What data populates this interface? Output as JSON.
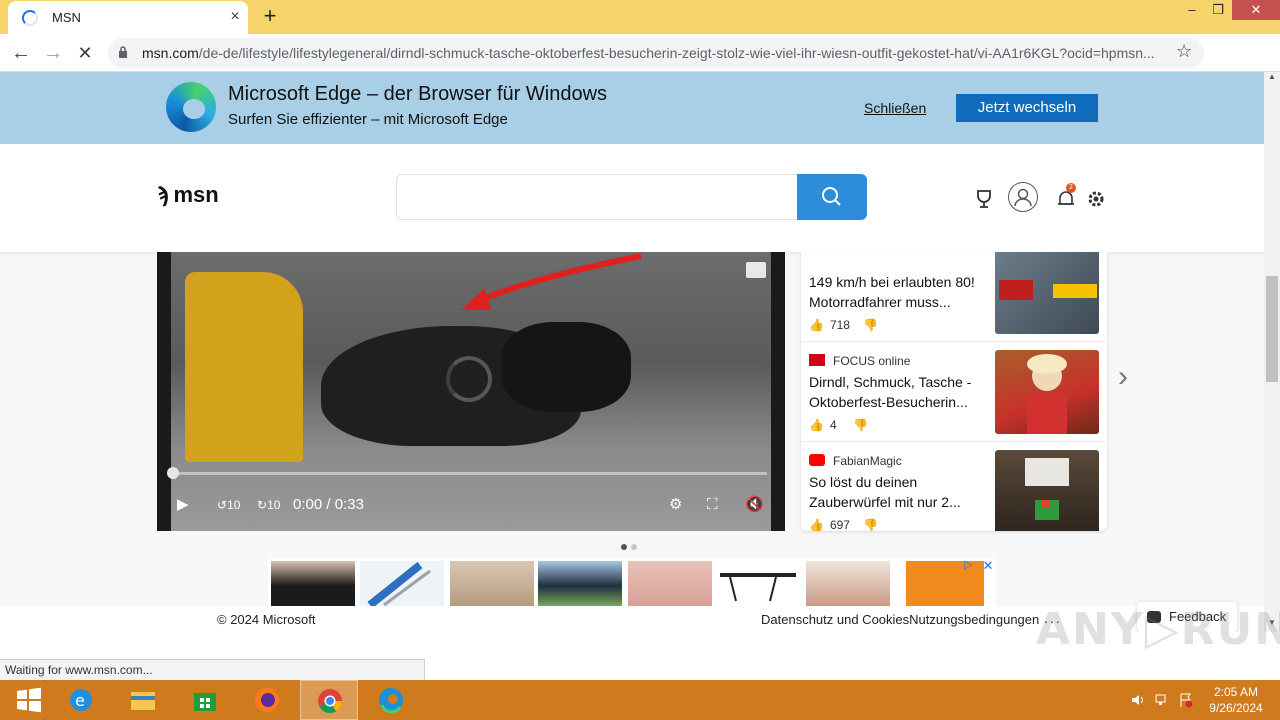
{
  "browser": {
    "tab_title": "MSN",
    "tab_close": "×",
    "new_tab": "+",
    "url_host": "msn.com",
    "url_path": "/de-de/lifestyle/lifestylegeneral/dirndl-schmuck-tasche-oktoberfest-besucherin-zeigt-stolz-wie-viel-ihr-wiesn-outfit-gekostet-hat/vi-AA1r6KGL?ocid=hpmsn...",
    "status_text": "Waiting for www.msn.com..."
  },
  "edge_banner": {
    "title": "Microsoft Edge – der Browser für Windows",
    "subtitle": "Surfen Sie effizienter – mit Microsoft Edge",
    "close_label": "Schließen",
    "switch_label": "Jetzt wechseln"
  },
  "msn": {
    "logo_text": "msn",
    "search_placeholder": "",
    "notification_count": "2"
  },
  "video": {
    "time_current": "0:00",
    "time_separator": "/",
    "time_total": "0:33",
    "progress": 0,
    "rewind_label": "10",
    "forward_label": "10"
  },
  "news": [
    {
      "source": "",
      "headline": "149 km/h bei erlaubten 80! Motorradfahrer muss...",
      "likes": "718",
      "source_color": "#333333"
    },
    {
      "source": "FOCUS online",
      "headline": "Dirndl, Schmuck, Tasche - Oktoberfest-Besucherin...",
      "likes": "4",
      "source_color": "#d0021b"
    },
    {
      "source": "FabianMagic",
      "headline": "So löst du deinen Zauberwürfel mit nur 2...",
      "likes": "697",
      "source_color": "#ff0000"
    }
  ],
  "footer": {
    "copyright": "© 2024 Microsoft",
    "links": "Datenschutz und CookiesNutzungsbedingungen",
    "more": "...",
    "feedback": "Feedback"
  },
  "taskbar": {
    "time": "2:05 AM",
    "date": "9/26/2024",
    "apps": [
      "start",
      "internet-explorer",
      "file-explorer",
      "store",
      "firefox",
      "chrome",
      "edge"
    ]
  },
  "colors": {
    "tab_strip": "#f6d46b",
    "edge_banner": "#a9cfe6",
    "edge_button": "#0f6cbd",
    "search_button": "#2e8ddb",
    "taskbar": "#cf7a1c"
  }
}
